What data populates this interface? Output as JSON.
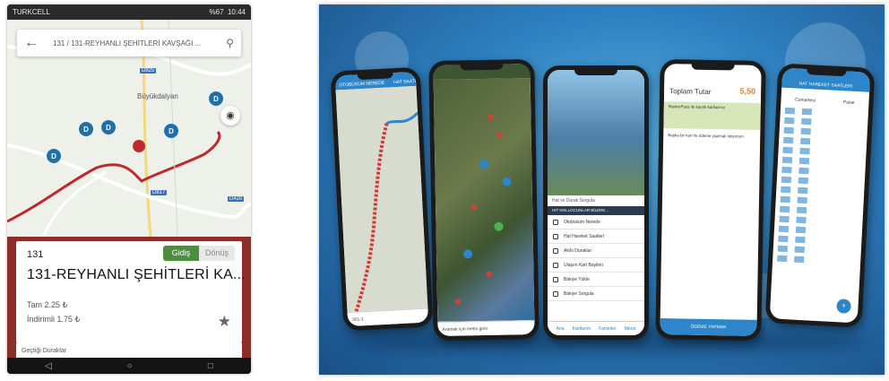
{
  "phone_screen": {
    "status": {
      "carrier": "TURKCELL",
      "indicators": "%67",
      "time": "10:44"
    },
    "search": {
      "text": "131 / 131-REYHANLI ŞEHİTLERİ KAVŞAĞI ..."
    },
    "map": {
      "place_label": "Büyükdalyan",
      "road_tags": [
        "D825",
        "D817",
        "D420"
      ],
      "stop_marker_letter": "D"
    },
    "route": {
      "number": "131",
      "direction_active": "Gidiş",
      "direction_inactive": "Dönüş",
      "name": "131-REYHANLI ŞEHİTLERİ KA...",
      "fare_full": "Tam 2.25 ₺",
      "fare_discount": "İndirimli 1.75 ₺",
      "stops_header": "Geçtiği Duraklar"
    },
    "nav_icons": [
      "back-triangle-icon",
      "home-circle-icon",
      "recent-square-icon"
    ],
    "colors": {
      "route_line": "#c0282d",
      "panel": "#8c2f28",
      "marker": "#1f6fa8",
      "active_toggle": "#4b8f3c"
    }
  },
  "promo": {
    "phone1": {
      "tabs": [
        "OTOBÜSÜM NEREDE",
        "HAT SAATİ"
      ],
      "footer": "301-1"
    },
    "phone2": {
      "footer": "Aramak için metin girin"
    },
    "phone3": {
      "search": "Hat ve Durak Sorgula",
      "banner": "HIT NOLLOCUNLAR BİLERE...",
      "menu": [
        "Otobüsüm Nerede",
        "Hat Hareket Saatleri",
        "Akıllı Duraklar",
        "Ulaşım Kart Bayileri",
        "Bakiye Yükle",
        "Bakiye Sorgula"
      ],
      "tabbar": [
        "Ana",
        "Kartlarım",
        "Favoriler",
        "Menü"
      ]
    },
    "phone4": {
      "title": "Toplam Tutar",
      "amount": "5,50",
      "masterpass": "MasterPass ile kayıtlı kartlarınız",
      "checkbox": "Başka bir kart ile ödeme yapmak istiyorum",
      "button": "ÖDEME YAPMAK"
    },
    "phone5": {
      "title": "HAT HAREKET SAATLERİ",
      "columns": [
        "Cumartesi",
        "Pazar"
      ]
    },
    "colors": {
      "accent": "#2c86c9",
      "bg": "#2d7fbf"
    }
  }
}
